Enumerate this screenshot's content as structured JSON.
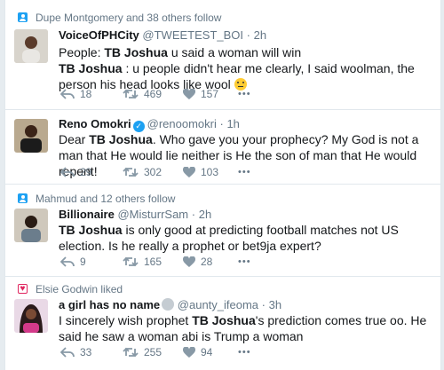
{
  "tweets": [
    {
      "context": "Dupe Montgomery and 38 others follow",
      "context_icon": "follow-icon",
      "name": "VoiceOfPHCity",
      "handle": "@TWEETEST_BOI",
      "time": "2h",
      "line1_prefix": "People: ",
      "line1_bold": "TB Joshua",
      "line1_suffix": " u said a woman will win",
      "line2_bold": "TB Joshua",
      "line2_suffix": " : u people didn't hear me clearly, I said woolman, the person his head looks like wool ",
      "reply": "18",
      "retweet": "469",
      "like": "157"
    },
    {
      "name": "Reno Omokri",
      "handle": "@renoomokri",
      "time": "1h",
      "text_prefix": "Dear ",
      "text_bold": "TB Joshua",
      "text_suffix": ". Who gave you your prophecy? My God is not a man that He would lie neither is He the son of man that He would repent!",
      "reply": "29",
      "retweet": "302",
      "like": "103"
    },
    {
      "context": "Mahmud and 12 others follow",
      "context_icon": "follow-icon",
      "name": "Billionaire",
      "handle": "@MisturrSam",
      "time": "2h",
      "text_bold": "TB Joshua",
      "text_suffix": " is only good at predicting football matches not US election. Is he really a prophet or bet9ja expert?",
      "reply": "9",
      "retweet": "165",
      "like": "28"
    },
    {
      "context": "Elsie Godwin liked",
      "context_icon": "like-icon",
      "name": "a girl has no name",
      "handle": "@aunty_ifeoma",
      "time": "3h",
      "text_prefix": "I sincerely wish prophet ",
      "text_bold": "TB Joshua",
      "text_suffix": "'s prediction comes true oo. He said he saw a woman abi is Trump a woman",
      "reply": "33",
      "retweet": "255",
      "like": "94"
    }
  ],
  "dot": "·",
  "more": "•••",
  "colors": {
    "accent": "#1da1f2",
    "text": "#14171a",
    "muted": "#657786",
    "like": "#e0245e"
  }
}
